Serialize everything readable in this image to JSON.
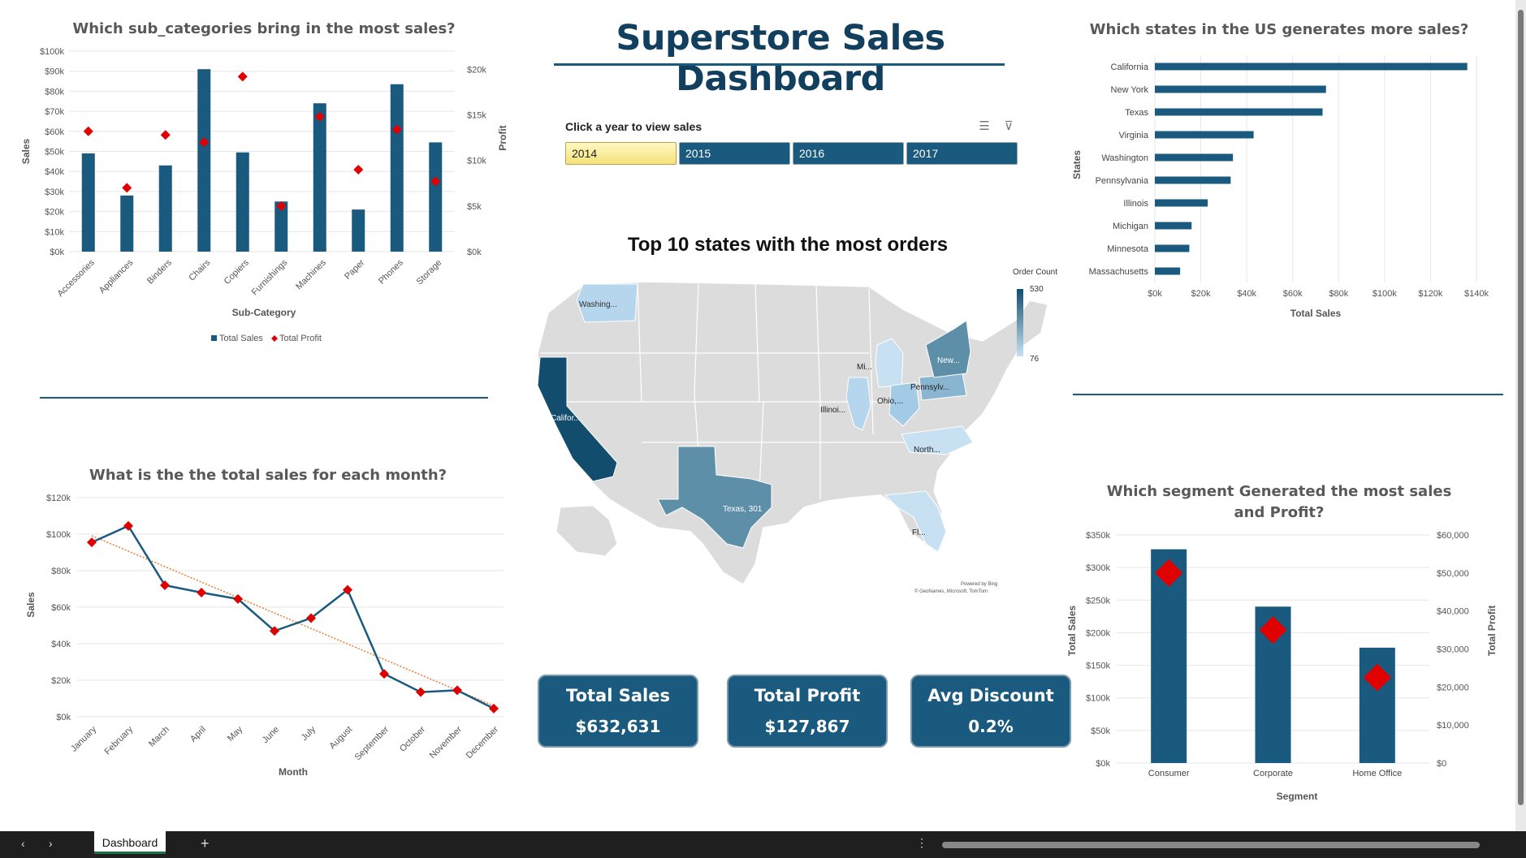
{
  "dashboard_title": "Superstore Sales Dashboard",
  "slicer": {
    "header": "Click a year to view sales",
    "years": [
      "2014",
      "2015",
      "2016",
      "2017"
    ],
    "selected": "2014"
  },
  "map": {
    "title": "Top 10 states with the most orders",
    "legend_title": "Order Count",
    "legend_max": "530",
    "legend_min": "76",
    "labels": [
      "Washing...",
      "Califor...",
      "Texas, 301",
      "New...",
      "Pennsylv...",
      "Ohio,...",
      "Illinoi...",
      "Mi...",
      "North...",
      "Fl..."
    ],
    "credit1": "Powered by Bing",
    "credit2": "© GeoNames, Microsoft, TomTom"
  },
  "kpis": {
    "sales_title": "Total Sales",
    "sales_value": "$632,631",
    "profit_title": "Total Profit",
    "profit_value": "$127,867",
    "discount_title": "Avg Discount",
    "discount_value": "0.2%"
  },
  "statusbar": {
    "sheet_tab": "Dashboard"
  },
  "colors": {
    "primary": "#1a5a7e",
    "marker": "#e00000",
    "trend": "#ed7d31"
  },
  "chart_data": [
    {
      "type": "bar",
      "title": "Which sub_categories bring in the most sales?",
      "xlabel": "Sub-Category",
      "ylabel": "Sales",
      "y2label": "Profit",
      "categories": [
        "Accessories",
        "Appliances",
        "Binders",
        "Chairs",
        "Copiers",
        "Furnishings",
        "Machines",
        "Paper",
        "Phones",
        "Storage"
      ],
      "series": [
        {
          "name": "Total Sales",
          "axis": "left",
          "values": [
            49000,
            28000,
            43000,
            91000,
            49500,
            25000,
            74000,
            21000,
            83500,
            54500
          ]
        },
        {
          "name": "Total Profit",
          "axis": "right",
          "values": [
            13200,
            7000,
            12800,
            12000,
            19200,
            5000,
            14800,
            9000,
            13400,
            7700
          ]
        }
      ],
      "yticks": [
        "$0k",
        "$10k",
        "$20k",
        "$30k",
        "$40k",
        "$50k",
        "$60k",
        "$70k",
        "$80k",
        "$90k",
        "$100k"
      ],
      "y2ticks": [
        "$0k",
        "$5k",
        "$10k",
        "$15k",
        "$20k"
      ],
      "ylim": [
        0,
        100000
      ],
      "y2lim": [
        0,
        22000
      ],
      "legend_position": "bottom"
    },
    {
      "type": "line",
      "title": "What is the the total sales for each  month?",
      "xlabel": "Month",
      "ylabel": "Sales",
      "categories": [
        "January",
        "February",
        "March",
        "April",
        "May",
        "June",
        "July",
        "August",
        "September",
        "October",
        "November",
        "December"
      ],
      "series": [
        {
          "values": [
            95500,
            104500,
            72000,
            68000,
            64500,
            47000,
            54000,
            69500,
            23500,
            13500,
            14500,
            4500
          ]
        }
      ],
      "trendline": true,
      "yticks": [
        "$0k",
        "$20k",
        "$40k",
        "$60k",
        "$80k",
        "$100k",
        "$120k"
      ],
      "ylim": [
        0,
        120000
      ]
    },
    {
      "type": "bar",
      "orientation": "horizontal",
      "title": "Which states in the US generates more sales?",
      "xlabel": "Total Sales",
      "ylabel": "States",
      "categories": [
        "California",
        "New York",
        "Texas",
        "Virginia",
        "Washington",
        "Pennsylvania",
        "Illinois",
        "Michigan",
        "Minnesota",
        "Massachusetts"
      ],
      "values": [
        136000,
        74500,
        73000,
        43000,
        34000,
        33000,
        23000,
        16000,
        15000,
        11000
      ],
      "xticks": [
        "$0k",
        "$20k",
        "$40k",
        "$60k",
        "$80k",
        "$100k",
        "$120k",
        "$140k"
      ],
      "xlim": [
        0,
        140000
      ]
    },
    {
      "type": "bar",
      "title": "Which segment Generated the most sales and Profit?",
      "xlabel": "Segment",
      "ylabel": "Total Sales",
      "y2label": "Total Profit",
      "categories": [
        "Consumer",
        "Corporate",
        "Home Office"
      ],
      "series": [
        {
          "name": "Total Sales",
          "axis": "left",
          "values": [
            328000,
            240000,
            177000
          ]
        },
        {
          "name": "Total Profit",
          "axis": "right",
          "values": [
            50000,
            35000,
            22500
          ]
        }
      ],
      "yticks": [
        "$0k",
        "$50k",
        "$100k",
        "$150k",
        "$200k",
        "$250k",
        "$300k",
        "$350k"
      ],
      "y2ticks": [
        "$0",
        "$10,000",
        "$20,000",
        "$30,000",
        "$40,000",
        "$50,000",
        "$60,000"
      ],
      "ylim": [
        0,
        350000
      ],
      "y2lim": [
        0,
        60000
      ]
    }
  ]
}
